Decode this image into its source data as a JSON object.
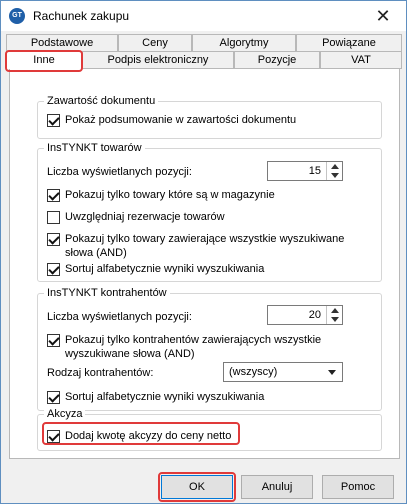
{
  "window": {
    "title": "Rachunek zakupu",
    "app_icon_text": "GT"
  },
  "tabs_row1": [
    "Podstawowe",
    "Ceny",
    "Algorytmy",
    "Powiązane"
  ],
  "tabs_row2": [
    "Inne",
    "Podpis elektroniczny",
    "Pozycje",
    "VAT"
  ],
  "active_tab": "Inne",
  "groups": {
    "zawartosc": {
      "title": "Zawartość dokumentu",
      "options": [
        {
          "label": "Pokaż podsumowanie w zawartości dokumentu",
          "checked": true
        }
      ]
    },
    "instynkt_towarow": {
      "title": "InsTYNKT towarów",
      "count_label": "Liczba wyświetlanych pozycji:",
      "count_value": "15",
      "options": [
        {
          "label": "Pokazuj tylko towary które są w magazynie",
          "checked": true
        },
        {
          "label": "Uwzględniaj rezerwacje towarów",
          "checked": false
        },
        {
          "label": "Pokazuj tylko towary zawierające wszystkie wyszukiwane\nsłowa (AND)",
          "checked": true
        },
        {
          "label": "Sortuj alfabetycznie wyniki wyszukiwania",
          "checked": true
        }
      ]
    },
    "instynkt_kontrahentow": {
      "title": "InsTYNKT kontrahentów",
      "count_label": "Liczba wyświetlanych pozycji:",
      "count_value": "20",
      "options": [
        {
          "label": "Pokazuj tylko kontrahentów zawierających wszystkie\nwyszukiwane słowa (AND)",
          "checked": true
        },
        {
          "label": "Sortuj alfabetycznie wyniki wyszukiwania",
          "checked": true
        }
      ],
      "rodzaj_label": "Rodzaj kontrahentów:",
      "rodzaj_value": "(wszyscy)"
    },
    "akcyza": {
      "title": "Akcyza",
      "options": [
        {
          "label": "Dodaj kwotę akcyzy do ceny netto",
          "checked": true
        }
      ]
    }
  },
  "buttons": {
    "ok": "OK",
    "cancel": "Anuluj",
    "help": "Pomoc"
  },
  "colors": {
    "highlight": "#e03a3a",
    "frame": "#5f8fc0"
  }
}
